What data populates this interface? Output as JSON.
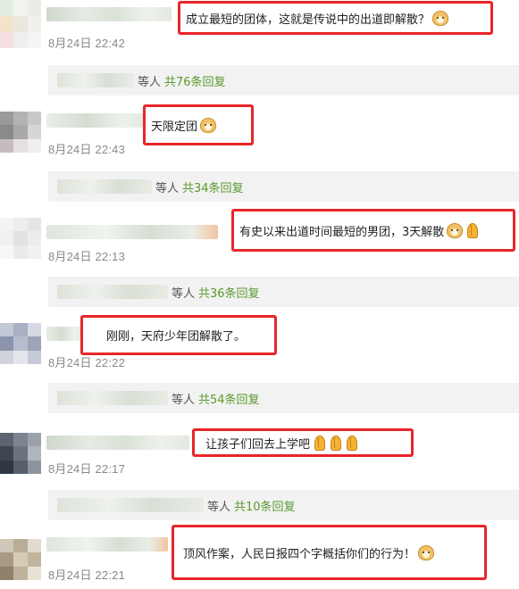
{
  "comments": [
    {
      "text": "成立最短的团体，这就是传说中的出道即解散？",
      "time": "8月24日 22:42",
      "emojis": [
        "doge-emoji"
      ]
    },
    {
      "text": "天限定团",
      "time": "8月24日 22:43",
      "emojis": [
        "doge-emoji"
      ]
    },
    {
      "text": "有史以来出道时间最短的男团，3天解散",
      "time": "8月24日 22:13",
      "emojis": [
        "doge-emoji",
        "pray-emoji"
      ]
    },
    {
      "text": "刚刚，天府少年团解散了。",
      "time": "8月24日 22:22",
      "emojis": []
    },
    {
      "text": "让孩子们回去上学吧",
      "time": "8月24日 22:17",
      "emojis": [
        "pray-emoji",
        "pray-emoji",
        "pray-emoji"
      ]
    },
    {
      "text": "顶风作案，人民日报四个字概括你们的行为！",
      "time": "8月24日 22:21",
      "emojis": [
        "doge-emoji"
      ]
    }
  ],
  "replies": [
    {
      "who": "等人",
      "count": "共76条回复"
    },
    {
      "who": "等人",
      "count": "共34条回复"
    },
    {
      "who": "等人",
      "count": "共36条回复"
    },
    {
      "who": "等人",
      "count": "共54条回复"
    },
    {
      "who": "等人",
      "count": "共10条回复"
    }
  ],
  "colors": {
    "highlight_border": "#e8262a",
    "reply_count": "#5a9a2c",
    "reply_bg": "#f2f2f2"
  }
}
